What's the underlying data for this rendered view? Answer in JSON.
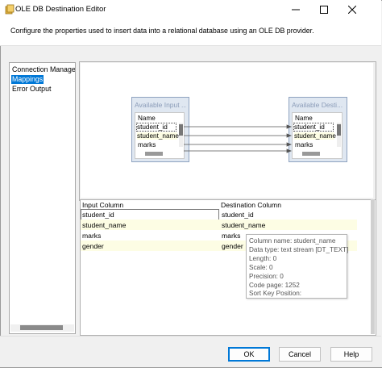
{
  "window": {
    "title": "OLE DB Destination Editor"
  },
  "description": "Configure the properties used to insert data into a relational database using an OLE DB provider.",
  "sidebar": {
    "items": [
      {
        "label": "Connection Manager",
        "selected": false
      },
      {
        "label": "Mappings",
        "selected": true
      },
      {
        "label": "Error Output",
        "selected": false
      }
    ]
  },
  "mapping": {
    "input_table": {
      "title": "Available Input ...",
      "header": "Name",
      "columns": [
        "student_id",
        "student_name",
        "marks"
      ]
    },
    "dest_table": {
      "title": "Available Desti...",
      "header": "Name",
      "columns": [
        "student_id",
        "student_name",
        "marks"
      ]
    }
  },
  "grid": {
    "headers": {
      "input": "Input Column",
      "destination": "Destination Column"
    },
    "rows": [
      {
        "input": "student_id",
        "destination": "student_id"
      },
      {
        "input": "student_name",
        "destination": "student_name"
      },
      {
        "input": "marks",
        "destination": "marks"
      },
      {
        "input": "gender",
        "destination": "gender"
      }
    ]
  },
  "tooltip": {
    "lines": [
      "Column name: student_name",
      "Data type: text stream [DT_TEXT]",
      "Length: 0",
      "Scale: 0",
      "Precision: 0",
      "Code page: 1252",
      "Sort Key Position:"
    ]
  },
  "buttons": {
    "ok": "OK",
    "cancel": "Cancel",
    "help": "Help"
  },
  "icons": {
    "app": "database-icon",
    "minimize": "minimize-icon",
    "maximize": "maximize-icon",
    "close": "close-icon"
  },
  "colors": {
    "accent": "#0078d7",
    "mapped_row": "#fdfde4",
    "table_header": "#dfe7f1"
  }
}
